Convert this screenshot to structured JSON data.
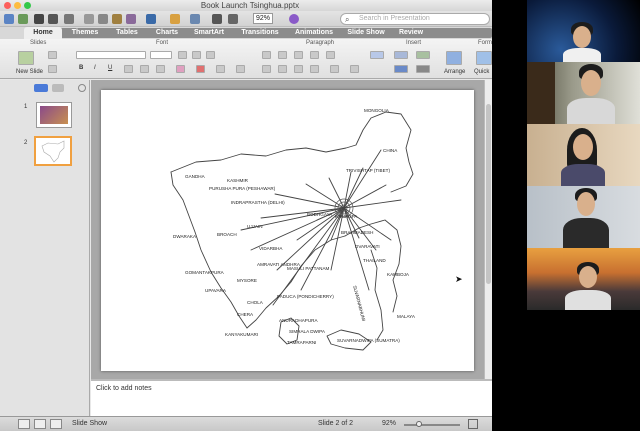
{
  "window": {
    "title": "Book Launch Tsinghua.pptx"
  },
  "toolbar": {
    "zoom": "92%",
    "search_placeholder": "Search in Presentation"
  },
  "ribbon": {
    "tabs": [
      "Home",
      "Themes",
      "Tables",
      "Charts",
      "SmartArt",
      "Transitions",
      "Animations",
      "Slide Show",
      "Review"
    ],
    "active_tab": "Home",
    "groups": [
      "Slides",
      "Font",
      "Paragraph",
      "Insert",
      "Form"
    ],
    "new_slide_label": "New Slide",
    "arrange_label": "Arrange",
    "quick_styles_label": "Quick"
  },
  "slides_panel": {
    "items": [
      {
        "number": "1"
      },
      {
        "number": "2"
      }
    ],
    "selected": "2"
  },
  "map_labels": {
    "mongolia": "MONGOLIA",
    "china": "CHINA",
    "tibet": "TRIVISHTAP (TIBET)",
    "gandha": "GANDHA",
    "kashmir": "KASHMIR",
    "purusha": "PURUSHA PURA (PESHAWAR)",
    "indraprastha": "INDRAPRASTHA (DELHI)",
    "kamrupa": "KAMRUPA",
    "bodhgaya": "BODHGAYA",
    "ujjain": "UJJAIN",
    "brahmadesh": "BRAHMADESH",
    "broach": "BROACH",
    "dwaraka": "DWARAKA",
    "vidarbha": "VIDARBHA",
    "suvarnabhumi": "SUVARNABHUMI",
    "dvaravati": "DVARAVATI",
    "kamboja": "KAMBOJA",
    "thailand": "THAILAND",
    "gomanturpura": "GOMANTAKPURA",
    "amravati": "AMRAVATI ANDHRA",
    "masulipatnam": "MASULI PATTANAM",
    "mysore": "MYSORE",
    "upmavara": "UPAVARA",
    "chola": "CHOLA",
    "chera": "CHERA",
    "paduca": "PADUCA (PONDICHERRY)",
    "kanyakumari": "KANYAKUMARI",
    "anuradhapura": "ANURADHAPURA",
    "simhala": "SIMHALA DWIPA",
    "tamraparni": "TAMRAPARNI",
    "malaya": "MALAYA",
    "suvarnadwipa": "SUVARNADWIPA (SUMATRA)"
  },
  "notes": {
    "placeholder": "Click to add notes"
  },
  "statusbar": {
    "view_label": "Slide Show",
    "slide_position": "Slide 2 of 2",
    "zoom": "92%"
  },
  "colors": {
    "accent": "#f0a040",
    "slide_bg": "#ffffff"
  }
}
